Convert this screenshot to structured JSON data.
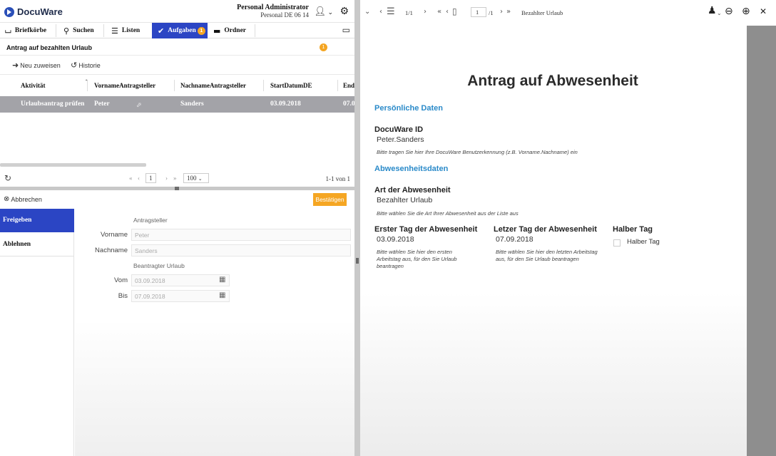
{
  "header": {
    "app_name": "DocuWare",
    "user_name": "Personal Administrator",
    "user_org": "Personal DE 06 14"
  },
  "nav": {
    "items": [
      {
        "label": "Briefkörbe",
        "icon": "tray-icon"
      },
      {
        "label": "Suchen",
        "icon": "search-icon"
      },
      {
        "label": "Listen",
        "icon": "list-icon"
      },
      {
        "label": "Aufgaben",
        "icon": "check-icon",
        "badge": "1",
        "active": true
      },
      {
        "label": "Ordner",
        "icon": "folder-icon"
      }
    ]
  },
  "task": {
    "title": "Antrag auf bezahlten Urlaub",
    "badge": "1",
    "reassign_label": "Neu zuweisen",
    "history_label": "Historie"
  },
  "table": {
    "columns": [
      "Aktivität",
      "VornameAntragsteller",
      "NachnameAntragsteller",
      "StartDatumDE",
      "End"
    ],
    "rows": [
      {
        "activity": "Urlaubsantrag prüfen",
        "first": "Peter",
        "last": "Sanders",
        "start": "03.09.2018",
        "end": "07.0"
      }
    ]
  },
  "pager": {
    "first": "«",
    "prev": "‹",
    "page": "1",
    "next": "›",
    "last": "»",
    "page_size": "100",
    "count": "1-1 von 1"
  },
  "actions": {
    "cancel_label": "Abbrechen",
    "confirm_label": "Bestätigen"
  },
  "decision": {
    "options": [
      "Freigeben",
      "Ablehnen"
    ]
  },
  "form": {
    "group1": "Antragsteller",
    "vorname_label": "Vorname",
    "vorname_value": "Peter",
    "nachname_label": "Nachname",
    "nachname_value": "Sanders",
    "group2": "Beantragter Urlaub",
    "vom_label": "Vom",
    "vom_value": "03.09.2018",
    "bis_label": "Bis",
    "bis_value": "07.09.2018"
  },
  "viewer": {
    "layers_count": "1/1",
    "page_current": "1",
    "page_total": "/1",
    "doc_name": "Bezahlter Urlaub"
  },
  "document": {
    "title": "Antrag auf Abwesenheit",
    "section1": "Persönliche Daten",
    "id_label": "DocuWare ID",
    "id_value": "Peter.Sanders",
    "id_hint": "Bitte tragen Sie hier Ihre DocuWare Benutzerkennung (z.B. Vorname.Nachname) ein",
    "section2": "Abwesenheitsdaten",
    "type_label": "Art der Abwesenheit",
    "type_value": "Bezahlter Urlaub",
    "type_hint": "Bitte wählen Sie die Art Ihrer Abwesenheit aus der Liste aus",
    "first_day_label": "Erster Tag der Abwesenheit",
    "first_day_value": "03.09.2018",
    "first_day_hint": "Bitte wählen Sie hier den ersten Arbeitstag aus, für den Sie Urlaub beantragen",
    "last_day_label": "Letzer Tag der Abwesenheit",
    "last_day_value": "07.09.2018",
    "last_day_hint": "Bitte wählen Sie hier den letzten Arbeitstag aus, für den Sie Urlaub beantragen",
    "half_day_label": "Halber Tag",
    "half_day_checkbox": "Halber Tag"
  }
}
